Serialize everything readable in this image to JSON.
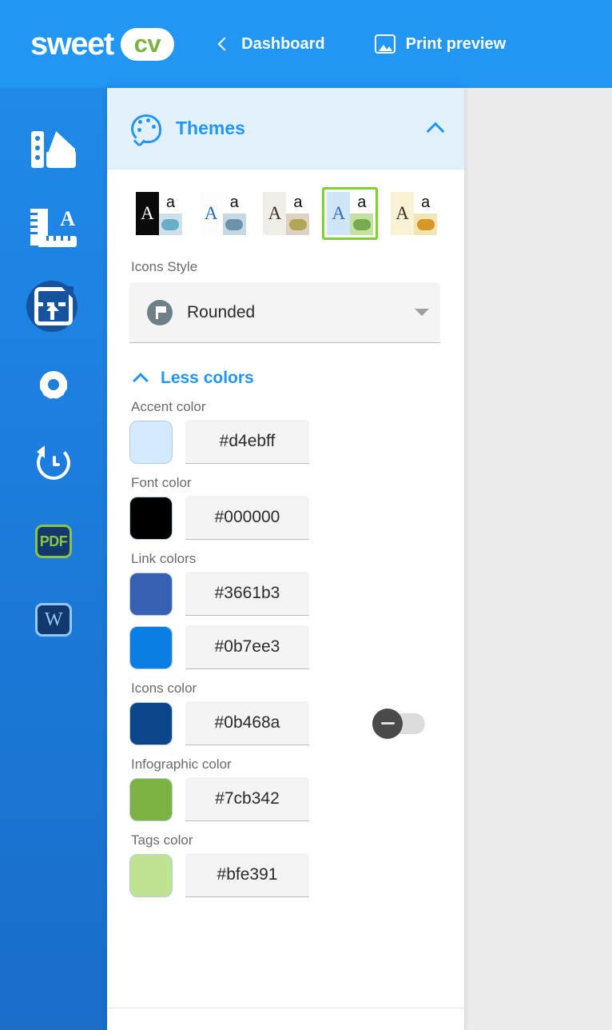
{
  "topbar": {
    "logo_word": "sweet",
    "logo_pill": "cv",
    "nav": [
      {
        "label": "Dashboard",
        "icon": "chevron-left-icon"
      },
      {
        "label": "Print preview",
        "icon": "image-icon"
      }
    ]
  },
  "sidebar": {
    "items": [
      {
        "name": "palette",
        "label": "Themes",
        "icon": "palette-swatch-icon",
        "active": false
      },
      {
        "name": "typography",
        "label": "Layout",
        "icon": "ruler-letter-icon",
        "active": false
      },
      {
        "name": "import",
        "label": "Import",
        "icon": "document-upload-icon",
        "active": true
      },
      {
        "name": "settings",
        "label": "Settings",
        "icon": "gear-icon",
        "active": false
      },
      {
        "name": "history",
        "label": "History",
        "icon": "history-clock-icon",
        "active": false
      },
      {
        "name": "pdf",
        "label": "PDF",
        "icon": "pdf-badge-icon",
        "active": false
      },
      {
        "name": "word",
        "label": "W",
        "icon": "word-badge-icon",
        "active": false
      }
    ]
  },
  "panel": {
    "title": "Themes",
    "title_icon": "palette-icon",
    "collapse_icon": "chevron-up-icon",
    "themes": [
      {
        "id": "theme-1",
        "left_bg": "#0a0a0a",
        "left_fg": "#ffffff",
        "top_bg": "#ffffff",
        "top_fg": "#111111",
        "bot_bg": "#cfe0e8",
        "dot": "#68aec9",
        "selected": false
      },
      {
        "id": "theme-2",
        "left_bg": "#fdfdfd",
        "left_fg": "#1f6fc4",
        "top_bg": "#ffffff",
        "top_fg": "#111111",
        "bot_bg": "#c6d8e2",
        "dot": "#6b93ab",
        "selected": false
      },
      {
        "id": "theme-3",
        "left_bg": "#efeee9",
        "left_fg": "#3a2f22",
        "top_bg": "#ffffff",
        "top_fg": "#111111",
        "bot_bg": "#e0d2c2",
        "dot": "#b0a656",
        "selected": false
      },
      {
        "id": "theme-4",
        "left_bg": "#cfe5f8",
        "left_fg": "#2f6fc0",
        "top_bg": "#ffffff",
        "top_fg": "#111111",
        "bot_bg": "#c5e0a0",
        "dot": "#76ab4e",
        "selected": true
      },
      {
        "id": "theme-5",
        "left_bg": "#f8f3d4",
        "left_fg": "#3a3220",
        "top_bg": "#ffffff",
        "top_fg": "#111111",
        "bot_bg": "#f2e4b4",
        "dot": "#d79726",
        "selected": false
      }
    ],
    "theme_sample_big": "A",
    "theme_sample_small": "a",
    "icons_style": {
      "label": "Icons Style",
      "value": "Rounded",
      "icon": "flag-circle-icon",
      "caret": "caret-down-icon"
    },
    "less_colors": {
      "label": "Less colors",
      "icon": "chevron-up-icon"
    },
    "colors": [
      {
        "label": "Accent color",
        "value": "#d4ebff",
        "swatch": "#d4ebff",
        "toggle": null
      },
      {
        "label": "Font color",
        "value": "#000000",
        "swatch": "#000000",
        "toggle": null
      },
      {
        "label": "Link colors",
        "value": "#3661b3",
        "swatch": "#3661b3",
        "toggle": null
      },
      {
        "label": "",
        "value": "#0b7ee3",
        "swatch": "#0b7ee3",
        "toggle": null
      },
      {
        "label": "Icons color",
        "value": "#0b468a",
        "swatch": "#0b468a",
        "toggle": "off"
      },
      {
        "label": "Infographic color",
        "value": "#7cb342",
        "swatch": "#7cb342",
        "toggle": null
      },
      {
        "label": "Tags color",
        "value": "#bfe391",
        "swatch": "#bfe391",
        "toggle": null
      }
    ]
  },
  "theme_colors": {
    "brand_blue": "#2196f3",
    "brand_green": "#7cb342",
    "selected_outline": "#7cd42f",
    "page_bg": "#ececec"
  }
}
